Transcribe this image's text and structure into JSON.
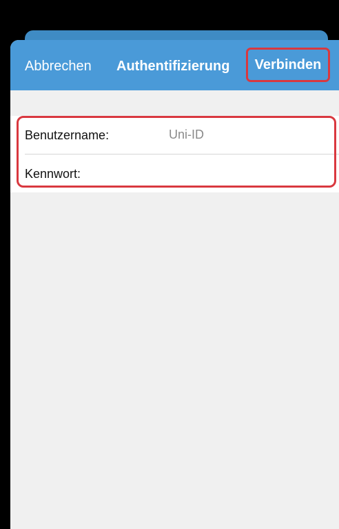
{
  "nav": {
    "cancel_label": "Abbrechen",
    "title": "Authentifizierung",
    "connect_label": "Verbinden"
  },
  "form": {
    "username": {
      "label": "Benutzername:",
      "value": "",
      "placeholder": "Uni-ID"
    },
    "password": {
      "label": "Kennwort:",
      "value": "",
      "placeholder": ""
    }
  },
  "colors": {
    "nav_background": "#4a9ad8",
    "highlight": "#d9383f",
    "sheet_background": "#f0f0f0"
  }
}
